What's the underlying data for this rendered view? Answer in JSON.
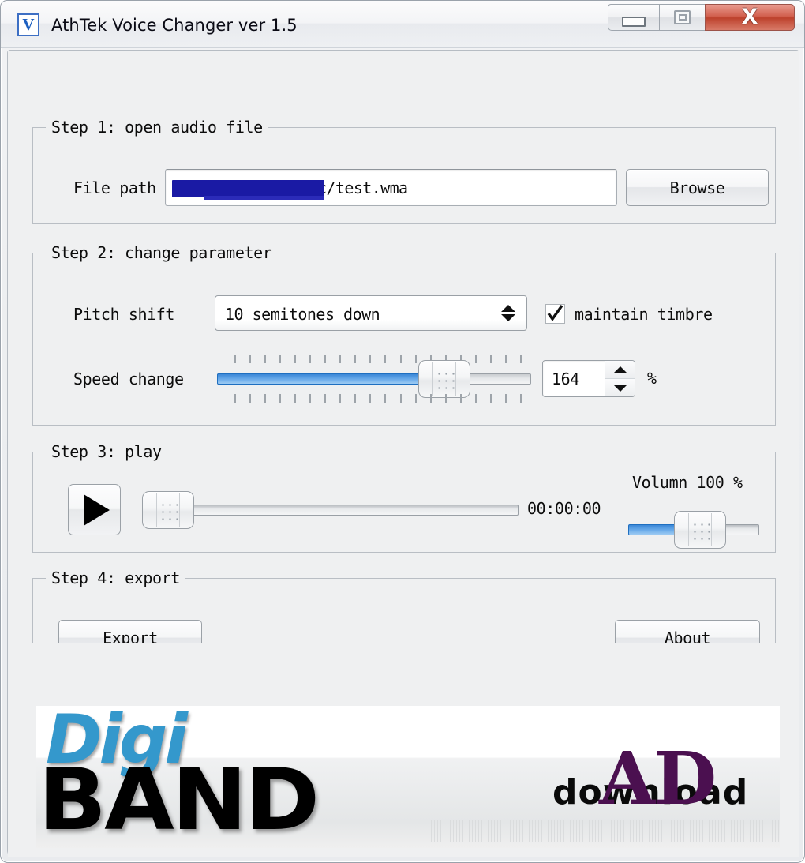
{
  "window": {
    "title": "AthTek Voice Changer ver 1.5",
    "icon_letter": "V",
    "icon_name": "app-icon-v",
    "controls": {
      "minimize": "minimize-icon",
      "maximize": "maximize-icon",
      "close": "X"
    },
    "accent_blue": "#3c88d8",
    "close_red": "#bd412c"
  },
  "step1": {
    "title": "Step 1: open audio file",
    "file_path_label": "File path",
    "file_path_value": "/VoiceChanger/Doc/test.wma",
    "file_path_redacted": true,
    "browse_label": "Browse"
  },
  "step2": {
    "title": "Step 2: change parameter",
    "pitch_label": "Pitch shift",
    "pitch_value": "10 semitones down",
    "maintain_timbre_label": "maintain timbre",
    "maintain_timbre_checked": true,
    "speed_label": "Speed change",
    "speed_value": "164",
    "speed_percent_sign": "%",
    "speed_fill_percent": 70,
    "speed_tick_count": 20
  },
  "step3": {
    "title": "Step 3: play",
    "play_icon": "play-icon",
    "seek_position_percent": 0,
    "time_display": "00:00:00",
    "volume_label": "Volumn 100 %",
    "volume_fill_percent": 38
  },
  "step4": {
    "title": "Step 4: export",
    "export_label": "Export",
    "about_label": "About"
  },
  "banner": {
    "logo_top": "Digi",
    "logo_bottom": "BAND",
    "logo_top_color": "#3498cc",
    "logo_bottom_color": "#000000",
    "download_text": "download",
    "ad_text": "AD",
    "ad_color": "#4b1050"
  }
}
